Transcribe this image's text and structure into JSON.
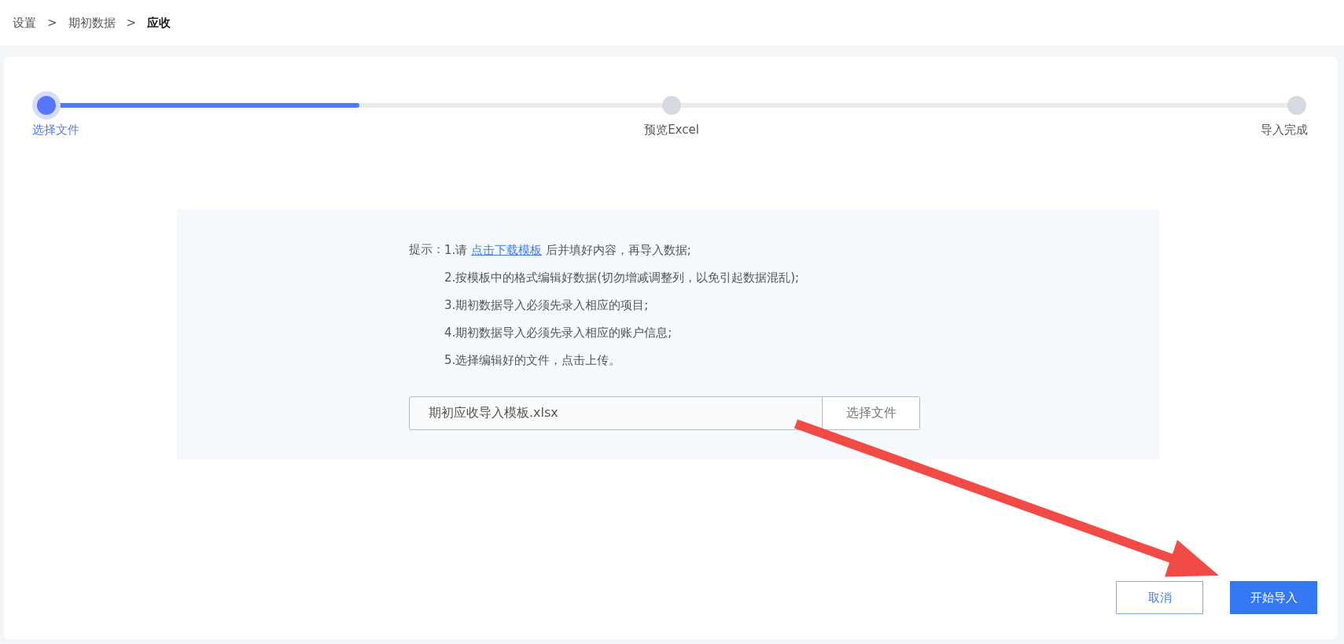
{
  "breadcrumb": [
    {
      "label": "设置",
      "current": false
    },
    {
      "label": "期初数据",
      "current": false
    },
    {
      "label": "应收",
      "current": true
    }
  ],
  "breadcrumb_separator": ">",
  "steps": {
    "items": [
      {
        "label": "选择文件",
        "selected": true
      },
      {
        "label": "预览Excel",
        "selected": false,
        "level": 0.5
      },
      {
        "label": "导入完成",
        "selected": false,
        "level": 0
      }
    ]
  },
  "tips": {
    "label": "提示：",
    "lines": [
      {
        "text": "1.请",
        "link": "点击下载模板",
        "rest": "后并填好内容，再导入数据;"
      },
      {
        "text": "2.按模板中的格式编辑好数据(切勿增减调整列，以免引起数据混乱);"
      },
      {
        "text": "3.期初数据导入必须先录入相应的项目;"
      },
      {
        "text": "4.期初数据导入必须先录入相应的账户信息;"
      },
      {
        "text": "5.选择编辑好的文件，点击上传。"
      }
    ]
  },
  "file": {
    "value": "期初应收导入模板.xlsx",
    "button": "选择文件"
  },
  "buttons": {
    "cancel": "取消",
    "start": "开始导入"
  }
}
